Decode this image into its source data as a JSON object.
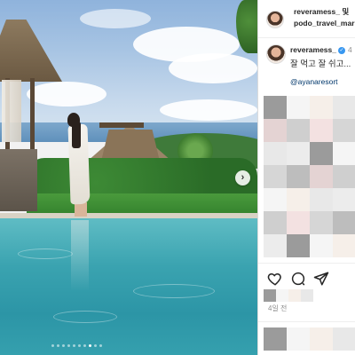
{
  "post": {
    "header": {
      "usernames_line1": "reveramess_ 및",
      "usernames_line2": "podo_travel_mar"
    },
    "caption": {
      "username": "reveramess_",
      "text": "잘 먹고 잘 쉬고...",
      "mention": "@ayanaresort"
    },
    "timestamp": "4일 전",
    "carousel": {
      "total": 10,
      "active_index": 7
    }
  },
  "icons": {
    "next": "chevron-right-icon",
    "like": "heart-icon",
    "comment": "comment-icon",
    "share": "send-icon",
    "verified": "verified-badge-icon"
  },
  "colors": {
    "verified": "#3897f0",
    "mention": "#00376b",
    "pool": "#3aa3b0"
  }
}
